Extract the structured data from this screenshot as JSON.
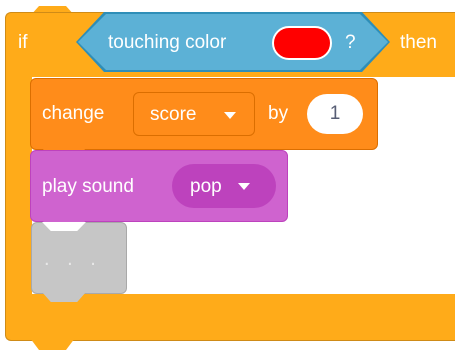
{
  "if_block": {
    "label_if": "if",
    "label_then": "then",
    "color": "#ffab19"
  },
  "condition": {
    "label": "touching color",
    "question": "?",
    "swatch_color": "#ff0000",
    "color": "#5cb1d6"
  },
  "change_block": {
    "label_change": "change",
    "variable": "score",
    "label_by": "by",
    "value": "1",
    "color": "#ff8c1a"
  },
  "sound_block": {
    "label": "play sound",
    "sound": "pop",
    "color": "#cf63cf"
  },
  "placeholder": {
    "label": ". . ."
  }
}
